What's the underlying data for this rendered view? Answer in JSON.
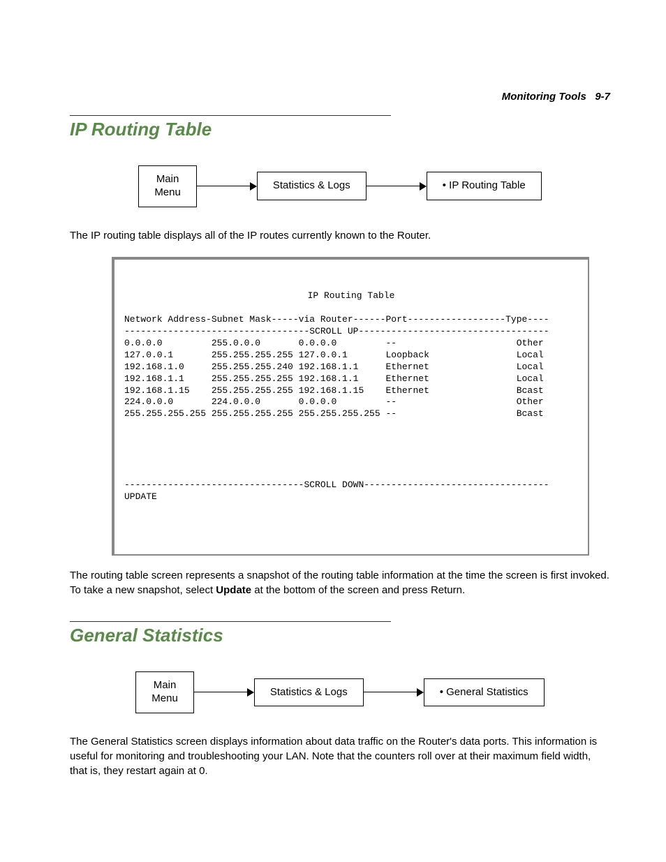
{
  "header": {
    "chapter": "Monitoring Tools",
    "page": "9-7"
  },
  "section1": {
    "title": "IP Routing Table",
    "nav": {
      "box1_line1": "Main",
      "box1_line2": "Menu",
      "box2": "Statistics & Logs",
      "box3": "• IP Routing Table"
    },
    "intro": "The IP routing table displays all of the IP routes currently known to the Router.",
    "terminal": {
      "title": "IP Routing Table",
      "header_row": "Network Address-Subnet Mask-----via Router------Port------------------Type----",
      "scroll_up": "----------------------------------SCROLL UP-----------------------------------",
      "rows": [
        {
          "net": "0.0.0.0",
          "mask": "255.0.0.0",
          "via": "0.0.0.0",
          "port": "--",
          "type": "Other"
        },
        {
          "net": "127.0.0.1",
          "mask": "255.255.255.255",
          "via": "127.0.0.1",
          "port": "Loopback",
          "type": "Local"
        },
        {
          "net": "192.168.1.0",
          "mask": "255.255.255.240",
          "via": "192.168.1.1",
          "port": "Ethernet",
          "type": "Local"
        },
        {
          "net": "192.168.1.1",
          "mask": "255.255.255.255",
          "via": "192.168.1.1",
          "port": "Ethernet",
          "type": "Local"
        },
        {
          "net": "192.168.1.15",
          "mask": "255.255.255.255",
          "via": "192.168.1.15",
          "port": "Ethernet",
          "type": "Bcast"
        },
        {
          "net": "224.0.0.0",
          "mask": "224.0.0.0",
          "via": "0.0.0.0",
          "port": "--",
          "type": "Other"
        },
        {
          "net": "255.255.255.255",
          "mask": "255.255.255.255",
          "via": "255.255.255.255",
          "port": "--",
          "type": "Bcast"
        }
      ],
      "scroll_down": "---------------------------------SCROLL DOWN----------------------------------",
      "update": "UPDATE"
    },
    "outro_pre": "The routing table screen represents a snapshot of the routing table information at the time the screen is first invoked. To take a new snapshot, select ",
    "outro_bold": "Update",
    "outro_post": " at the bottom of the screen and press Return."
  },
  "section2": {
    "title": "General Statistics",
    "nav": {
      "box1_line1": "Main",
      "box1_line2": "Menu",
      "box2": "Statistics & Logs",
      "box3": "• General Statistics"
    },
    "intro": "The General Statistics screen displays information about data traffic on the Router's data ports. This information is useful for monitoring and troubleshooting your LAN. Note that the counters roll over at their maximum field width, that is, they restart again at 0."
  }
}
